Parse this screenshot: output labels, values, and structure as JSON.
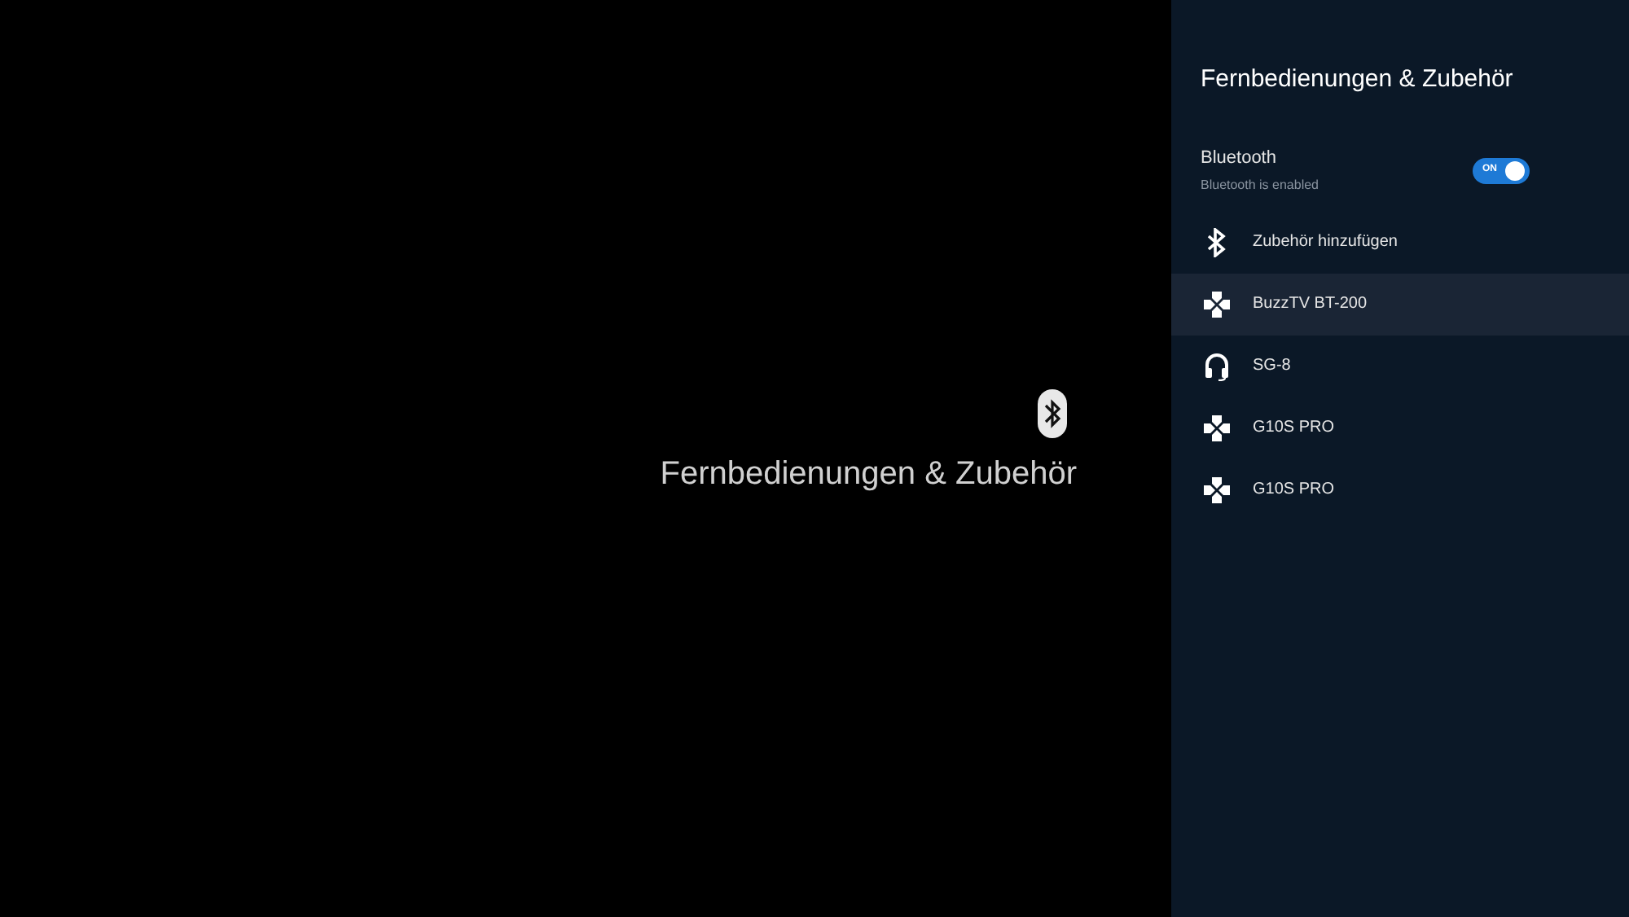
{
  "main": {
    "title": "Fernbedienungen & Zubehör"
  },
  "panel": {
    "title": "Fernbedienungen & Zubehör",
    "bluetooth": {
      "label": "Bluetooth",
      "subtitle": "Bluetooth is enabled",
      "on": true,
      "toggle_label": "ON"
    },
    "items": [
      {
        "kind": "bluetooth",
        "label": "Zubehör hinzufügen",
        "selected": false
      },
      {
        "kind": "gamepad",
        "label": "BuzzTV BT-200",
        "selected": true
      },
      {
        "kind": "headset",
        "label": "SG-8",
        "selected": false
      },
      {
        "kind": "gamepad",
        "label": "G10S PRO",
        "selected": false
      },
      {
        "kind": "gamepad",
        "label": "G10S PRO",
        "selected": false
      }
    ]
  }
}
